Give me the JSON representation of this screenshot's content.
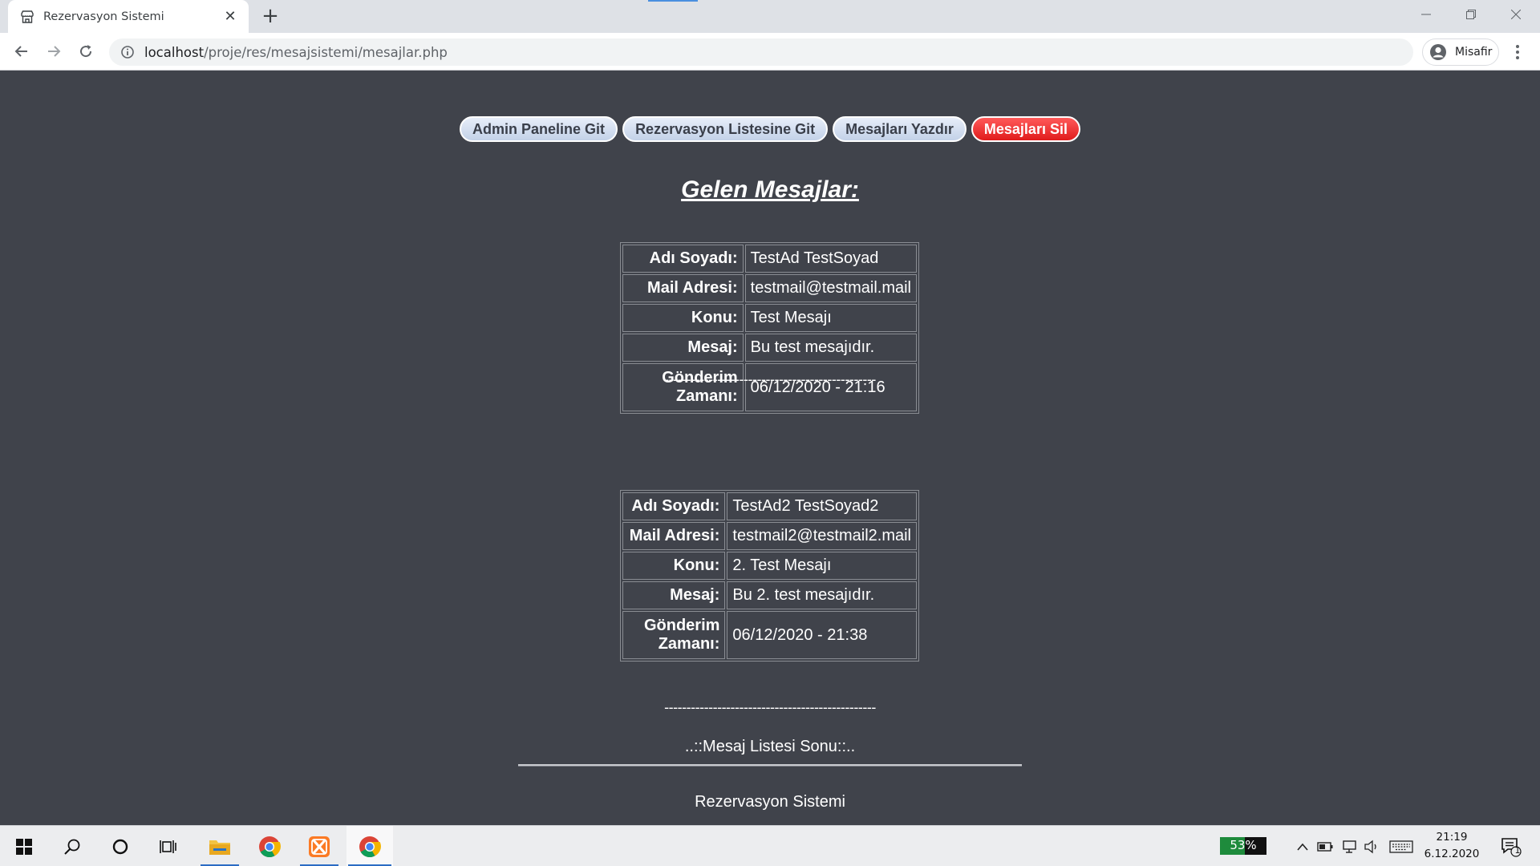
{
  "browser": {
    "tab_title": "Rezervasyon Sistemi",
    "tab_close": "✕",
    "new_tab": "+",
    "url_host": "localhost",
    "url_path": "/proje/res/mesajsistemi/mesajlar.php",
    "profile_label": "Misafir"
  },
  "nav": {
    "admin_label": "Admin Paneline Git",
    "reservations_label": "Rezervasyon Listesine Git",
    "print_label": "Mesajları Yazdır",
    "delete_label": "Mesajları Sil"
  },
  "heading": "Gelen Mesajlar:",
  "labels": {
    "name": "Adı Soyadı:",
    "mail": "Mail Adresi:",
    "subject": "Konu:",
    "message": "Mesaj:",
    "sent_line1": "Gönderim",
    "sent_line2": "Zamanı:"
  },
  "messages": [
    {
      "name": "TestAd TestSoyad",
      "mail": "testmail@testmail.mail",
      "subject": "Test Mesajı",
      "message": "Bu test mesajıdır.",
      "sent": "06/12/2020 - 21:16"
    },
    {
      "name": "TestAd2 TestSoyad2",
      "mail": "testmail2@testmail2.mail",
      "subject": "2. Test Mesajı",
      "message": "Bu 2. test mesajıdır.",
      "sent": "06/12/2020 - 21:38"
    }
  ],
  "separator": "------------------------------------------------",
  "end_text": "..::Mesaj Listesi Sonu::..",
  "footer": "Rezervasyon Sistemi",
  "taskbar": {
    "battery_percent": "53%",
    "battery_level": 0.53,
    "time": "21:19",
    "date": "6.12.2020",
    "notification_count": "1"
  },
  "colors": {
    "page_bg": "#40434b",
    "pill_bg": "#c3d2e8",
    "danger_bg": "#e01c1c"
  }
}
